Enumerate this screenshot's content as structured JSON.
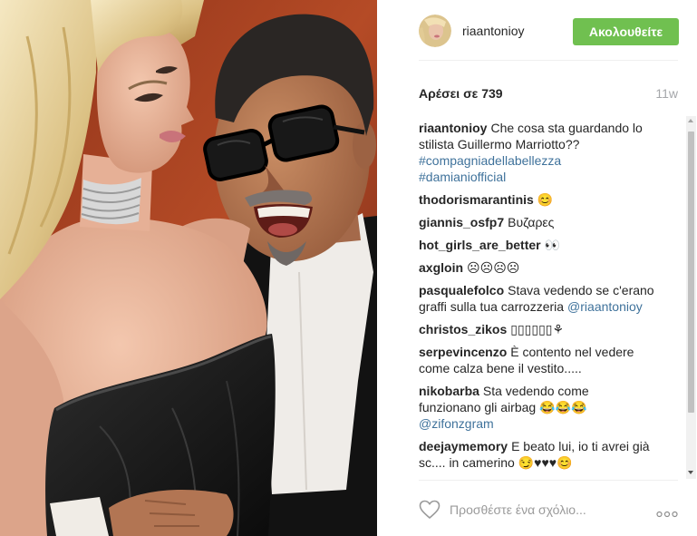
{
  "header": {
    "username": "riaantonioy",
    "follow_label": "Ακολουθείτε"
  },
  "likes": {
    "text": "Αρέσει σε 739",
    "age": "11w"
  },
  "comments": [
    {
      "user": "riaantonioy",
      "lines": [
        "Che cosa sta guardando lo",
        "stilista Guillermo Marriotto??"
      ],
      "hashtags": [
        "#compagniadellabellezza",
        "#damianiofficial"
      ]
    },
    {
      "user": "thodorismarantinis",
      "text": "😊"
    },
    {
      "user": "giannis_osfp7",
      "text": "Βυζαρες"
    },
    {
      "user": "hot_girls_are_better",
      "text": "👀"
    },
    {
      "user": "axgloin",
      "text": "☹☹☹☹"
    },
    {
      "user": "pasqualefolco",
      "lines": [
        "Stava vedendo se c'erano",
        "graffi sulla tua carrozzeria"
      ],
      "mention": "@riaantonioy"
    },
    {
      "user": "christos_zikos",
      "text": "▯▯▯▯▯▯⚘"
    },
    {
      "user": "serpevincenzo",
      "lines": [
        "È contento nel vedere",
        "come calza bene il vestito....."
      ]
    },
    {
      "user": "nikobarba",
      "lines": [
        "Sta vedendo come",
        "funzionano gli airbag 😂😂😂"
      ],
      "mention": "@zifonzgram"
    },
    {
      "user": "deejaymemory",
      "lines": [
        "E beato lui, io ti avrei già",
        "sc.... in camerino 😏♥♥♥😊"
      ]
    }
  ],
  "add_comment": {
    "placeholder": "Προσθέστε ένα σχόλιο..."
  },
  "icons": {
    "like": "heart-outline-icon",
    "more": "more-options-icon",
    "avatar": "avatar"
  },
  "colors": {
    "follow_button": "#70c050",
    "link": "#3f729b",
    "text": "#262626",
    "muted": "#a5a7aa"
  }
}
